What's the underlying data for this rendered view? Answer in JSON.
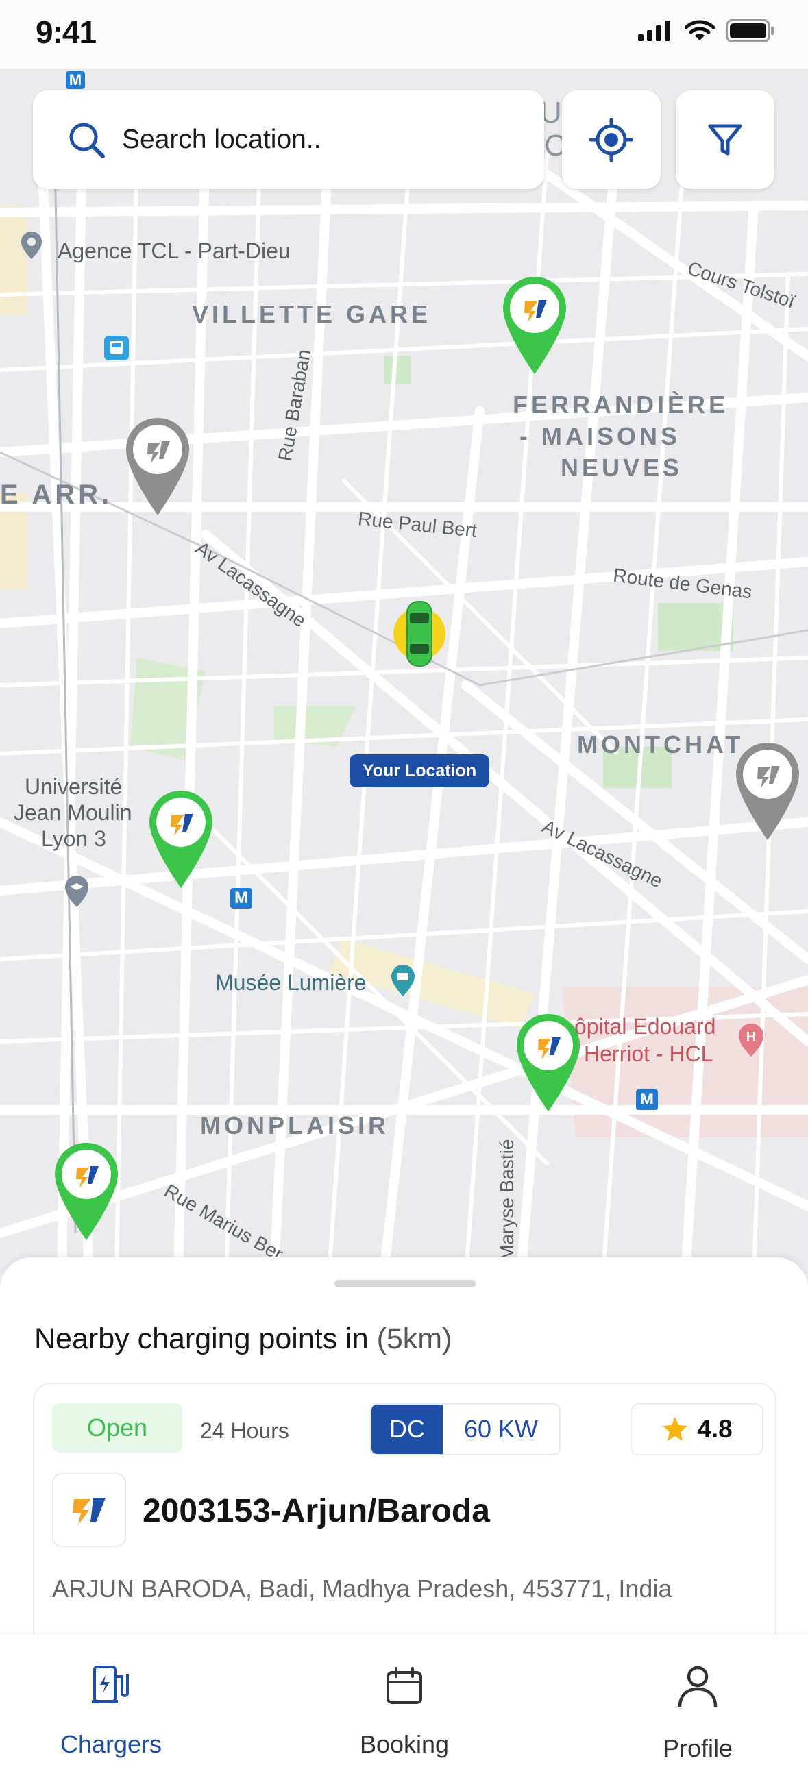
{
  "status_bar": {
    "time": "9:41"
  },
  "search": {
    "placeholder": "Search location.."
  },
  "map": {
    "labels": {
      "agence": "Agence TCL - Part-Dieu",
      "villette": "VILLETTE GARE",
      "ferrandiere_1": "FERRANDIÈRE",
      "ferrandiere_2": "- MAISONS",
      "ferrandiere_3": "NEUVES",
      "arr": "E ARR.",
      "rue_baraban": "Rue Baraban",
      "rue_paul_bert": "Rue Paul Bert",
      "av_lacassagne_1": "Av Lacassagne",
      "route_genas": "Route de Genas",
      "cours_tolstoi": "Cours Tolstoï",
      "montchat": "MONTCHAT",
      "universite_1": "Université",
      "universite_2": "Jean Moulin",
      "universite_3": "Lyon 3",
      "av_lacassagne_2": "Av Lacassagne",
      "musee": "Musée Lumière",
      "hopital_1": "ôpital Edouard",
      "hopital_2": "Herriot - HCL",
      "monplaisir": "MONPLAISIR",
      "rue_marius": "Rue Marius Ber",
      "maryse": "Maryse Bastié",
      "metro": "M",
      "top_partial_1": "U",
      "top_partial_2": "C"
    },
    "your_location": "Your Location"
  },
  "nearby": {
    "title": "Nearby charging points in ",
    "radius": "(5km)"
  },
  "station": {
    "status": "Open",
    "hours": "24 Hours",
    "type": "DC",
    "power": "60 KW",
    "rating": "4.8",
    "name": "2003153-Arjun/Baroda",
    "address": "ARJUN BARODA, Badi, Madhya Pradesh, 453771, India"
  },
  "tabs": [
    {
      "label": "Chargers",
      "icon": "ev-station-icon",
      "active": true
    },
    {
      "label": "Booking",
      "icon": "calendar-icon",
      "active": false
    },
    {
      "label": "Profile",
      "icon": "person-icon",
      "active": false
    }
  ],
  "colors": {
    "primary": "#1d4fa7",
    "open_green": "#3cbc50",
    "pin_green": "#3bc64a",
    "pin_gray": "#8e8e8e",
    "star": "#f6b40e"
  }
}
